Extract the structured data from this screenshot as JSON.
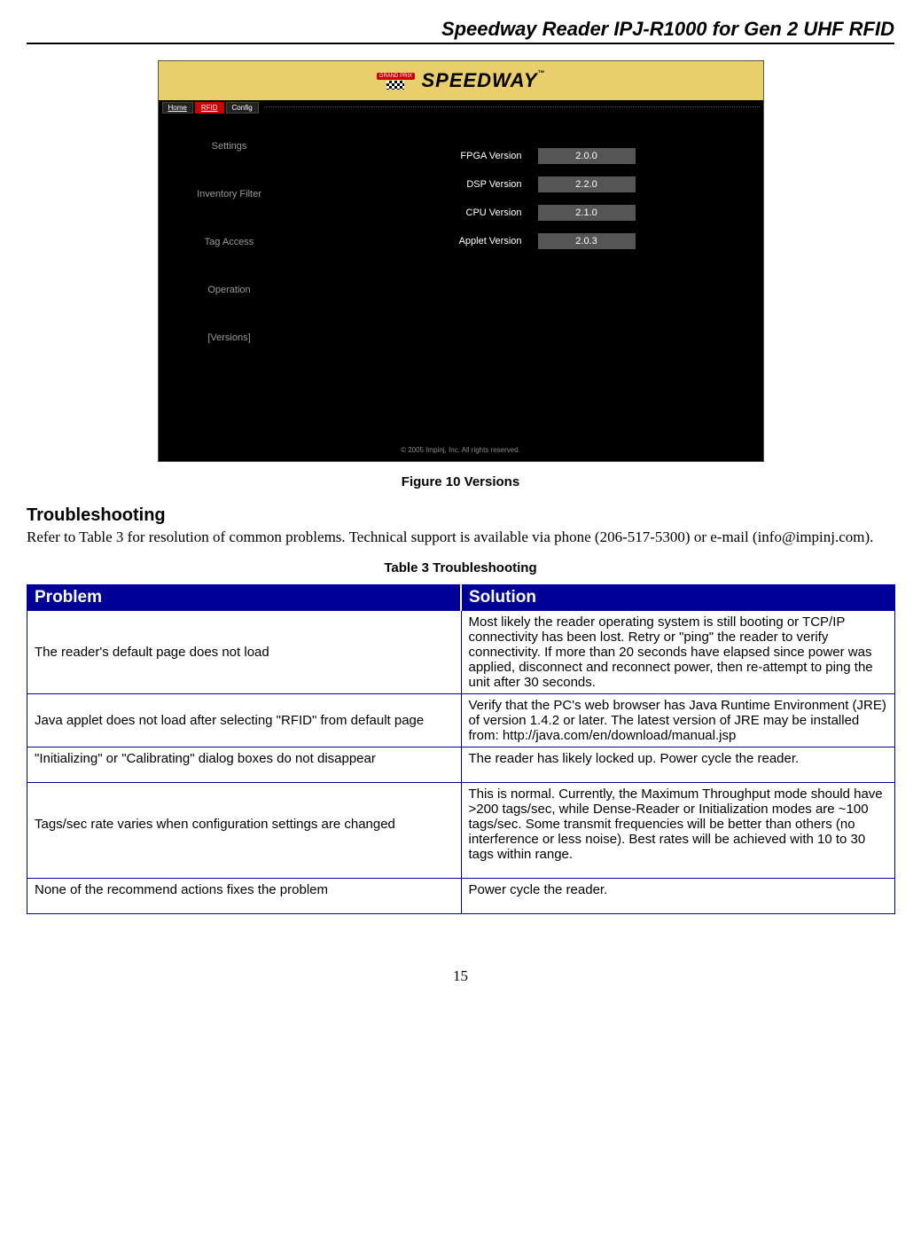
{
  "header": {
    "title": "Speedway Reader IPJ-R1000 for Gen 2 UHF RFID"
  },
  "screenshot": {
    "logo_badge": "GRAND PRIX",
    "logo_text": "SPEEDWAY",
    "logo_tm": "™",
    "tabs": {
      "home": "Home",
      "rfid": "RFID",
      "config": "Config"
    },
    "sidebar": {
      "settings": "Settings",
      "inventory": "Inventory Filter",
      "tag": "Tag Access",
      "operation": "Operation",
      "versions": "[Versions]"
    },
    "versions": {
      "fpga_label": "FPGA Version",
      "fpga_val": "2.0.0",
      "dsp_label": "DSP Version",
      "dsp_val": "2.2.0",
      "cpu_label": "CPU Version",
      "cpu_val": "2.1.0",
      "applet_label": "Applet Version",
      "applet_val": "2.0.3"
    },
    "footer": "© 2005 Impinj, Inc. All rights reserved."
  },
  "figure_caption": "Figure 10  Versions",
  "troubleshooting": {
    "heading": "Troubleshooting",
    "body": "Refer to Table 3 for resolution of common problems. Technical support is available via phone (206-517-5300) or e-mail (info@impinj.com).",
    "table_caption": "Table 3  Troubleshooting",
    "col_problem": "Problem",
    "col_solution": "Solution",
    "rows": [
      {
        "problem": "The reader's default page does not load",
        "solution": "Most likely the reader operating system is still booting or TCP/IP connectivity has been lost. Retry or \"ping\" the reader to verify connectivity. If more than 20 seconds have elapsed since power was applied, disconnect and reconnect power, then re-attempt to ping the unit after 30 seconds."
      },
      {
        "problem": "Java applet does not load after selecting \"RFID\" from default page",
        "solution": "Verify that the PC's web browser has Java Runtime Environment (JRE) of version 1.4.2 or later. The latest version of JRE may be installed from: http://java.com/en/download/manual.jsp"
      },
      {
        "problem": "\"Initializing\" or \"Calibrating\" dialog boxes do not disappear",
        "solution": "The reader has likely locked up. Power cycle the reader."
      },
      {
        "problem": "Tags/sec rate varies when configuration settings are changed",
        "solution": "This is normal. Currently, the Maximum Throughput mode should have >200 tags/sec, while Dense-Reader or Initialization modes are ~100 tags/sec. Some transmit frequencies will be better than others (no interference or less noise). Best rates will be achieved with 10 to 30 tags within range."
      },
      {
        "problem": "None of the recommend actions fixes the problem",
        "solution": "Power cycle the reader."
      }
    ]
  },
  "page_number": "15"
}
